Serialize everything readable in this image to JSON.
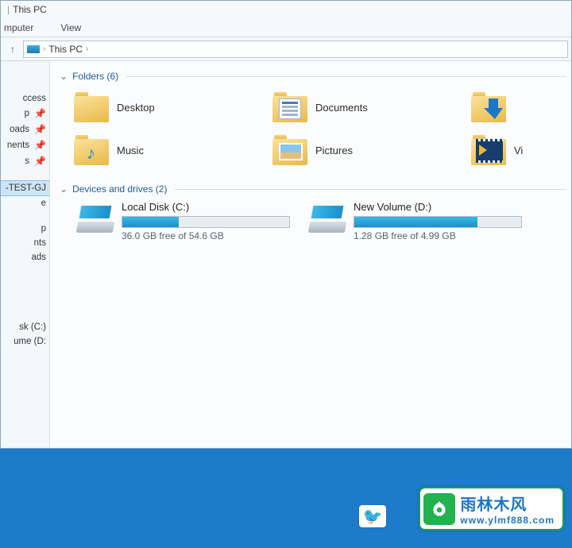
{
  "title": {
    "sep": "|",
    "text": "This PC"
  },
  "ribbon": {
    "tabs": [
      "mputer",
      "View"
    ]
  },
  "address": {
    "arrow_up": "↑",
    "sep": "›",
    "location": "This PC",
    "sep2": "›"
  },
  "nav": {
    "items": [
      {
        "label": "ccess",
        "pinned": false
      },
      {
        "label": "p",
        "pinned": true
      },
      {
        "label": "oads",
        "pinned": true
      },
      {
        "label": "nents",
        "pinned": true
      },
      {
        "label": "s",
        "pinned": true
      },
      {
        "label": "",
        "pinned": false
      },
      {
        "label": "-TEST-GJ",
        "pinned": false,
        "selected": true
      },
      {
        "label": "e",
        "pinned": false
      },
      {
        "label": "",
        "pinned": false
      },
      {
        "label": "",
        "pinned": false
      },
      {
        "label": "p",
        "pinned": false
      },
      {
        "label": "nts",
        "pinned": false
      },
      {
        "label": "ads",
        "pinned": false
      },
      {
        "label": "",
        "pinned": false
      },
      {
        "label": "",
        "pinned": false
      },
      {
        "label": "",
        "pinned": false
      },
      {
        "label": "sk (C:)",
        "pinned": false
      },
      {
        "label": "ume (D:",
        "pinned": false
      }
    ]
  },
  "groups": {
    "folders": {
      "title": "Folders (6)",
      "items": [
        {
          "label": "Desktop"
        },
        {
          "label": "Documents"
        },
        {
          "label": ""
        },
        {
          "label": "Music"
        },
        {
          "label": "Pictures"
        },
        {
          "label": "Vi"
        }
      ]
    },
    "drives": {
      "title": "Devices and drives (2)",
      "items": [
        {
          "name": "Local Disk (C:)",
          "free_text": "36.0 GB free of 54.6 GB",
          "fill_pct": 34
        },
        {
          "name": "New Volume (D:)",
          "free_text": "1.28 GB free of 4.99 GB",
          "fill_pct": 74
        }
      ]
    }
  },
  "watermark": {
    "cn": "雨林木风",
    "url": "www.ylmf888.com"
  }
}
